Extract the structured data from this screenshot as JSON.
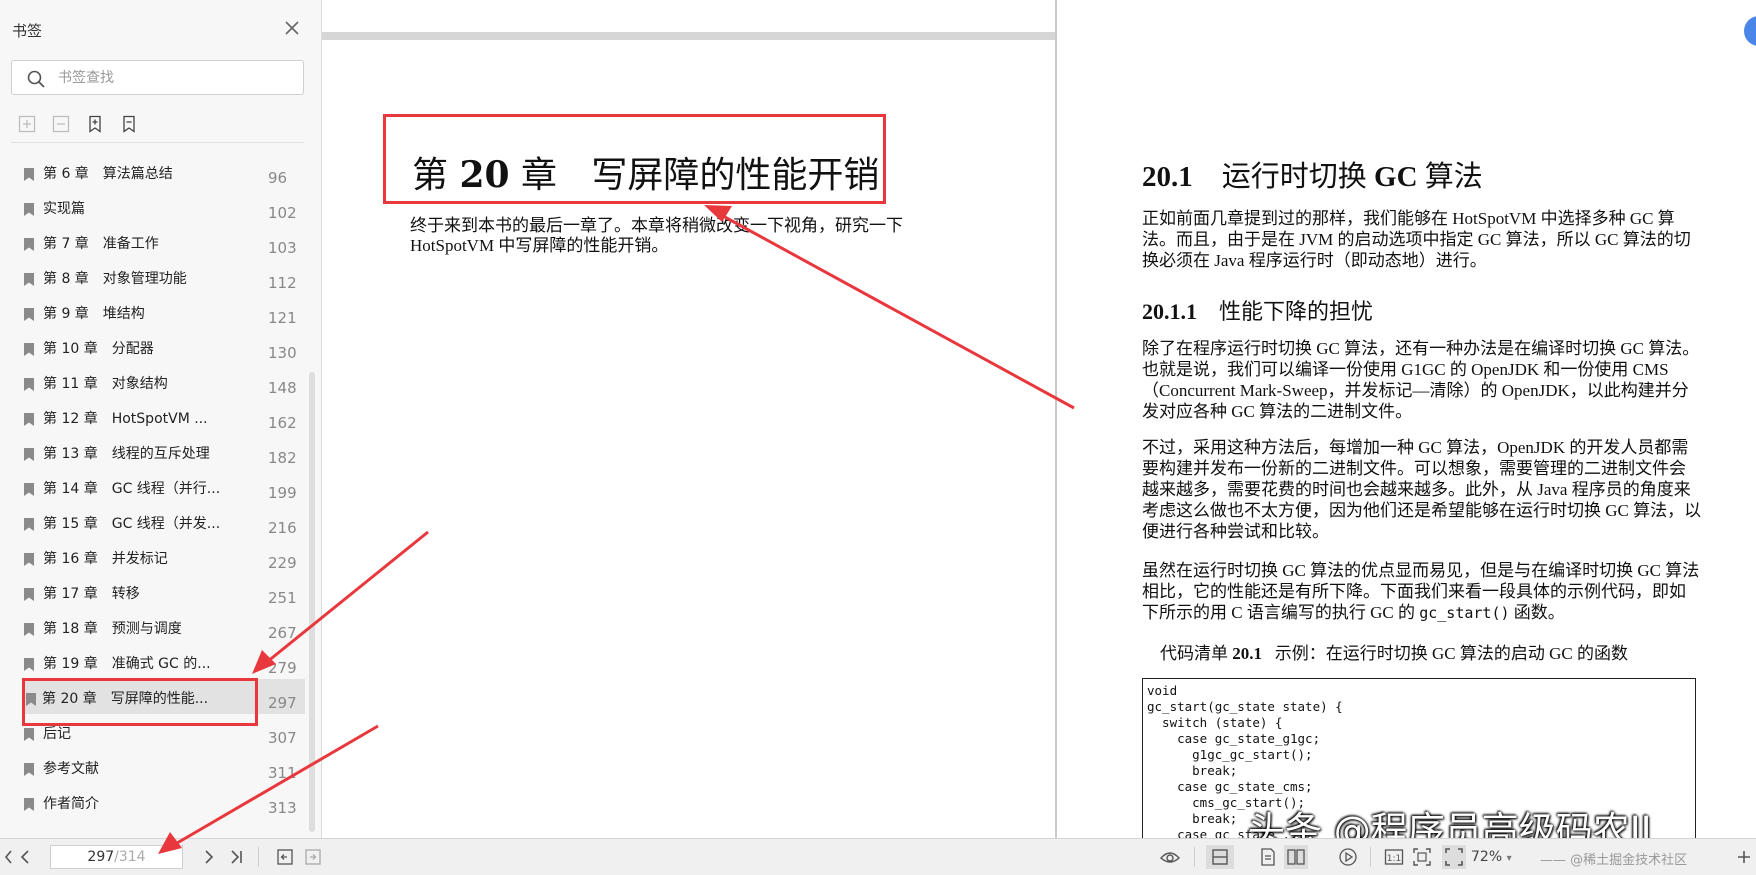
{
  "sidebar": {
    "title": "书签",
    "search_placeholder": "书签查找",
    "tools": [
      "expand-all-icon",
      "collapse-all-icon",
      "add-bookmark-icon",
      "delete-bookmark-icon"
    ],
    "items": [
      {
        "label": "第 6 章　算法篇总结",
        "page": "96"
      },
      {
        "label": "实现篇",
        "page": "102"
      },
      {
        "label": "第 7 章　准备工作",
        "page": "103"
      },
      {
        "label": "第 8 章　对象管理功能",
        "page": "112"
      },
      {
        "label": "第 9 章　堆结构",
        "page": "121"
      },
      {
        "label": "第 10 章　分配器",
        "page": "130"
      },
      {
        "label": "第 11 章　对象结构",
        "page": "148"
      },
      {
        "label": "第 12 章　HotSpotVM ...",
        "page": "162"
      },
      {
        "label": "第 13 章　线程的互斥处理",
        "page": "182"
      },
      {
        "label": "第 14 章　GC 线程（并行...",
        "page": "199"
      },
      {
        "label": "第 15 章　GC 线程（并发...",
        "page": "216"
      },
      {
        "label": "第 16 章　并发标记",
        "page": "229"
      },
      {
        "label": "第 17 章　转移",
        "page": "251"
      },
      {
        "label": "第 18 章　预测与调度",
        "page": "267"
      },
      {
        "label": "第 19 章　准确式 GC 的...",
        "page": "279"
      },
      {
        "label": "第 20 章　写屏障的性能...",
        "page": "297",
        "active": true
      },
      {
        "label": "后记",
        "page": "307"
      },
      {
        "label": "参考文献",
        "page": "311"
      },
      {
        "label": "作者简介",
        "page": "313"
      }
    ]
  },
  "left_page": {
    "chapter_prefix": "第",
    "chapter_num": "20",
    "chapter_suffix": "章",
    "chapter_title": "写屏障的性能开销",
    "intro": "终于来到本书的最后一章了。本章将稍微改变一下视角，研究一下 HotSpotVM 中写屏障的性能开销。"
  },
  "right_page": {
    "section_num": "20.1",
    "section_title_a": "运行时切换",
    "section_title_b": "GC",
    "section_title_c": "算法",
    "para1": "正如前面几章提到过的那样，我们能够在 HotSpotVM 中选择多种 GC 算法。而且，由于是在 JVM 的启动选项中指定 GC 算法，所以 GC 算法的切换必须在 Java 程序运行时（即动态地）进行。",
    "subsection_num": "20.1.1",
    "subsection_title": "性能下降的担忧",
    "para2": "除了在程序运行时切换 GC 算法，还有一种办法是在编译时切换 GC 算法。也就是说，我们可以编译一份使用 G1GC 的 OpenJDK 和一份使用 CMS（Concurrent Mark-Sweep，并发标记—清除）的 OpenJDK，以此构建并分发对应各种 GC 算法的二进制文件。",
    "para3": "不过，采用这种方法后，每增加一种 GC 算法，OpenJDK 的开发人员都需要构建并发布一份新的二进制文件。可以想象，需要管理的二进制文件会越来越多，需要花费的时间也会越来越多。此外，从 Java 程序员的角度来考虑这么做也不太方便，因为他们还是希望能够在运行时切换 GC 算法，以便进行各种尝试和比较。",
    "para4_pre": "虽然在运行时切换 GC 算法的优点显而易见，但是与在编译时切换 GC 算法相比，它的性能还是有所下降。下面我们来看一段具体的示例代码，即如下所示的用 C 语言编写的执行 GC 的 ",
    "para4_code": "gc_start()",
    "para4_post": " 函数。",
    "listing_label": "代码清单",
    "listing_num": "20.1",
    "listing_caption": "示例：在运行时切换 GC 算法的启动 GC 的函数",
    "code": "void\ngc_start(gc_state state) {\n  switch (state) {\n    case gc_state_g1gc;\n      g1gc_gc_start();\n      break;\n    case gc_state_cms;\n      cms_gc_start();\n      break;\n    case gc_state_..."
  },
  "watermark": "头条 @程序员高级码农II",
  "statusbar": {
    "current_page": "297",
    "total_pages": "/314",
    "zoom": "72%",
    "footer_text": "@稀土掘金技术社区"
  },
  "colors": {
    "annotation_red": "#e8383d",
    "active_bookmark_bg": "#e2e2e2",
    "accent_blue": "#4a86e8"
  }
}
